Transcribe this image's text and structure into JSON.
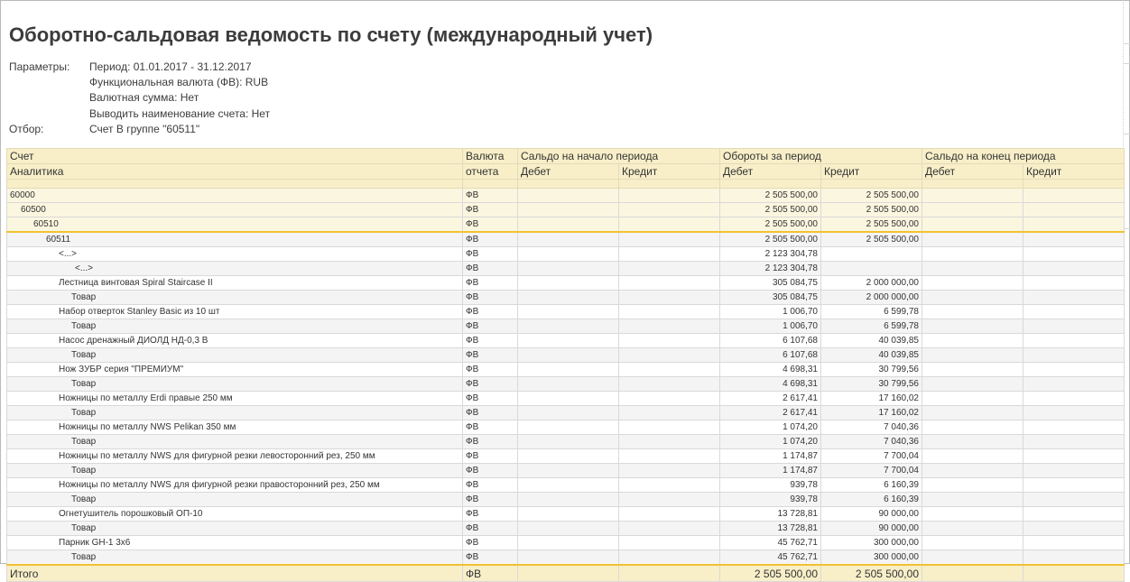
{
  "report": {
    "title": "Оборотно-сальдовая ведомость по счету (международный учет)",
    "params_label": "Параметры:",
    "params": [
      "Период: 01.01.2017 - 31.12.2017",
      "Функциональная валюта (ФВ): RUB",
      "Валютная сумма: Нет",
      "Выводить наименование счета: Нет"
    ],
    "filter_label": "Отбор:",
    "filter_value": "Счет В группе \"60511\""
  },
  "table": {
    "headers": {
      "account": "Счет",
      "analytics": "Аналитика",
      "currency_1": "Валюта",
      "currency_2": "отчета",
      "opening": "Сальдо на начало периода",
      "turnover": "Обороты за период",
      "closing": "Сальдо на конец периода",
      "debit": "Дебет",
      "credit": "Кредит"
    },
    "rows": [
      {
        "name": "60000",
        "cur": "ФВ",
        "od": "",
        "oc": "",
        "td": "2 505 500,00",
        "tc": "2 505 500,00",
        "cd": "",
        "cc": ""
      },
      {
        "name": "60500",
        "cur": "ФВ",
        "od": "",
        "oc": "",
        "td": "2 505 500,00",
        "tc": "2 505 500,00",
        "cd": "",
        "cc": ""
      },
      {
        "name": "60510",
        "cur": "ФВ",
        "od": "",
        "oc": "",
        "td": "2 505 500,00",
        "tc": "2 505 500,00",
        "cd": "",
        "cc": ""
      },
      {
        "name": "60511",
        "cur": "ФВ",
        "od": "",
        "oc": "",
        "td": "2 505 500,00",
        "tc": "2 505 500,00",
        "cd": "",
        "cc": ""
      },
      {
        "name": "<...>",
        "cur": "ФВ",
        "od": "",
        "oc": "",
        "td": "2 123 304,78",
        "tc": "",
        "cd": "",
        "cc": ""
      },
      {
        "name": "<...>",
        "cur": "ФВ",
        "od": "",
        "oc": "",
        "td": "2 123 304,78",
        "tc": "",
        "cd": "",
        "cc": ""
      },
      {
        "name": "Лестница винтовая Spiral Staircase II",
        "cur": "ФВ",
        "od": "",
        "oc": "",
        "td": "305 084,75",
        "tc": "2 000 000,00",
        "cd": "",
        "cc": ""
      },
      {
        "name": "Товар",
        "cur": "ФВ",
        "od": "",
        "oc": "",
        "td": "305 084,75",
        "tc": "2 000 000,00",
        "cd": "",
        "cc": ""
      },
      {
        "name": "Набор отверток Stanley Basic из 10 шт",
        "cur": "ФВ",
        "od": "",
        "oc": "",
        "td": "1 006,70",
        "tc": "6 599,78",
        "cd": "",
        "cc": ""
      },
      {
        "name": "Товар",
        "cur": "ФВ",
        "od": "",
        "oc": "",
        "td": "1 006,70",
        "tc": "6 599,78",
        "cd": "",
        "cc": ""
      },
      {
        "name": "Насос дренажный ДИОЛД НД-0,3 В",
        "cur": "ФВ",
        "od": "",
        "oc": "",
        "td": "6 107,68",
        "tc": "40 039,85",
        "cd": "",
        "cc": ""
      },
      {
        "name": "Товар",
        "cur": "ФВ",
        "od": "",
        "oc": "",
        "td": "6 107,68",
        "tc": "40 039,85",
        "cd": "",
        "cc": ""
      },
      {
        "name": "Нож ЗУБР серия \"ПРЕМИУМ\"",
        "cur": "ФВ",
        "od": "",
        "oc": "",
        "td": "4 698,31",
        "tc": "30 799,56",
        "cd": "",
        "cc": ""
      },
      {
        "name": "Товар",
        "cur": "ФВ",
        "od": "",
        "oc": "",
        "td": "4 698,31",
        "tc": "30 799,56",
        "cd": "",
        "cc": ""
      },
      {
        "name": "Ножницы по металлу Erdi правые 250 мм",
        "cur": "ФВ",
        "od": "",
        "oc": "",
        "td": "2 617,41",
        "tc": "17 160,02",
        "cd": "",
        "cc": ""
      },
      {
        "name": "Товар",
        "cur": "ФВ",
        "od": "",
        "oc": "",
        "td": "2 617,41",
        "tc": "17 160,02",
        "cd": "",
        "cc": ""
      },
      {
        "name": "Ножницы по металлу NWS Pelikan 350 мм",
        "cur": "ФВ",
        "od": "",
        "oc": "",
        "td": "1 074,20",
        "tc": "7 040,36",
        "cd": "",
        "cc": ""
      },
      {
        "name": "Товар",
        "cur": "ФВ",
        "od": "",
        "oc": "",
        "td": "1 074,20",
        "tc": "7 040,36",
        "cd": "",
        "cc": ""
      },
      {
        "name": "Ножницы по металлу NWS для фигурной резки левосторонний рез, 250 мм",
        "cur": "ФВ",
        "od": "",
        "oc": "",
        "td": "1 174,87",
        "tc": "7 700,04",
        "cd": "",
        "cc": ""
      },
      {
        "name": "Товар",
        "cur": "ФВ",
        "od": "",
        "oc": "",
        "td": "1 174,87",
        "tc": "7 700,04",
        "cd": "",
        "cc": ""
      },
      {
        "name": "Ножницы по металлу NWS для фигурной резки правосторонний рез, 250 мм",
        "cur": "ФВ",
        "od": "",
        "oc": "",
        "td": "939,78",
        "tc": "6 160,39",
        "cd": "",
        "cc": ""
      },
      {
        "name": "Товар",
        "cur": "ФВ",
        "od": "",
        "oc": "",
        "td": "939,78",
        "tc": "6 160,39",
        "cd": "",
        "cc": ""
      },
      {
        "name": "Огнетушитель порошковый ОП-10",
        "cur": "ФВ",
        "od": "",
        "oc": "",
        "td": "13 728,81",
        "tc": "90 000,00",
        "cd": "",
        "cc": ""
      },
      {
        "name": "Товар",
        "cur": "ФВ",
        "od": "",
        "oc": "",
        "td": "13 728,81",
        "tc": "90 000,00",
        "cd": "",
        "cc": ""
      },
      {
        "name": "Парник GH-1 3х6",
        "cur": "ФВ",
        "od": "",
        "oc": "",
        "td": "45 762,71",
        "tc": "300 000,00",
        "cd": "",
        "cc": ""
      },
      {
        "name": "Товар",
        "cur": "ФВ",
        "od": "",
        "oc": "",
        "td": "45 762,71",
        "tc": "300 000,00",
        "cd": "",
        "cc": ""
      }
    ],
    "total": {
      "label": "Итого",
      "cur": "ФВ",
      "td": "2 505 500,00",
      "tc": "2 505 500,00"
    }
  }
}
